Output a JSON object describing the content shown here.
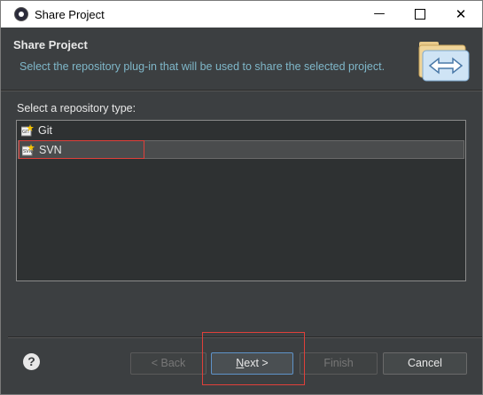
{
  "window": {
    "title": "Share Project"
  },
  "header": {
    "title": "Share Project",
    "description": "Select the repository plug-in that will be used to share the selected project."
  },
  "list": {
    "label": "Select a repository type:",
    "items": [
      {
        "label": "Git",
        "icon": "git-repository-icon",
        "selected": false
      },
      {
        "label": "SVN",
        "icon": "svn-repository-icon",
        "selected": true
      }
    ]
  },
  "buttons": {
    "back": "< Back",
    "next_mnemonic": "N",
    "next_rest": "ext >",
    "finish": "Finish",
    "cancel": "Cancel",
    "help": "?"
  },
  "colors": {
    "background": "#3c3f41",
    "accent_text": "#7fb7c9",
    "highlight": "#e0403a"
  }
}
